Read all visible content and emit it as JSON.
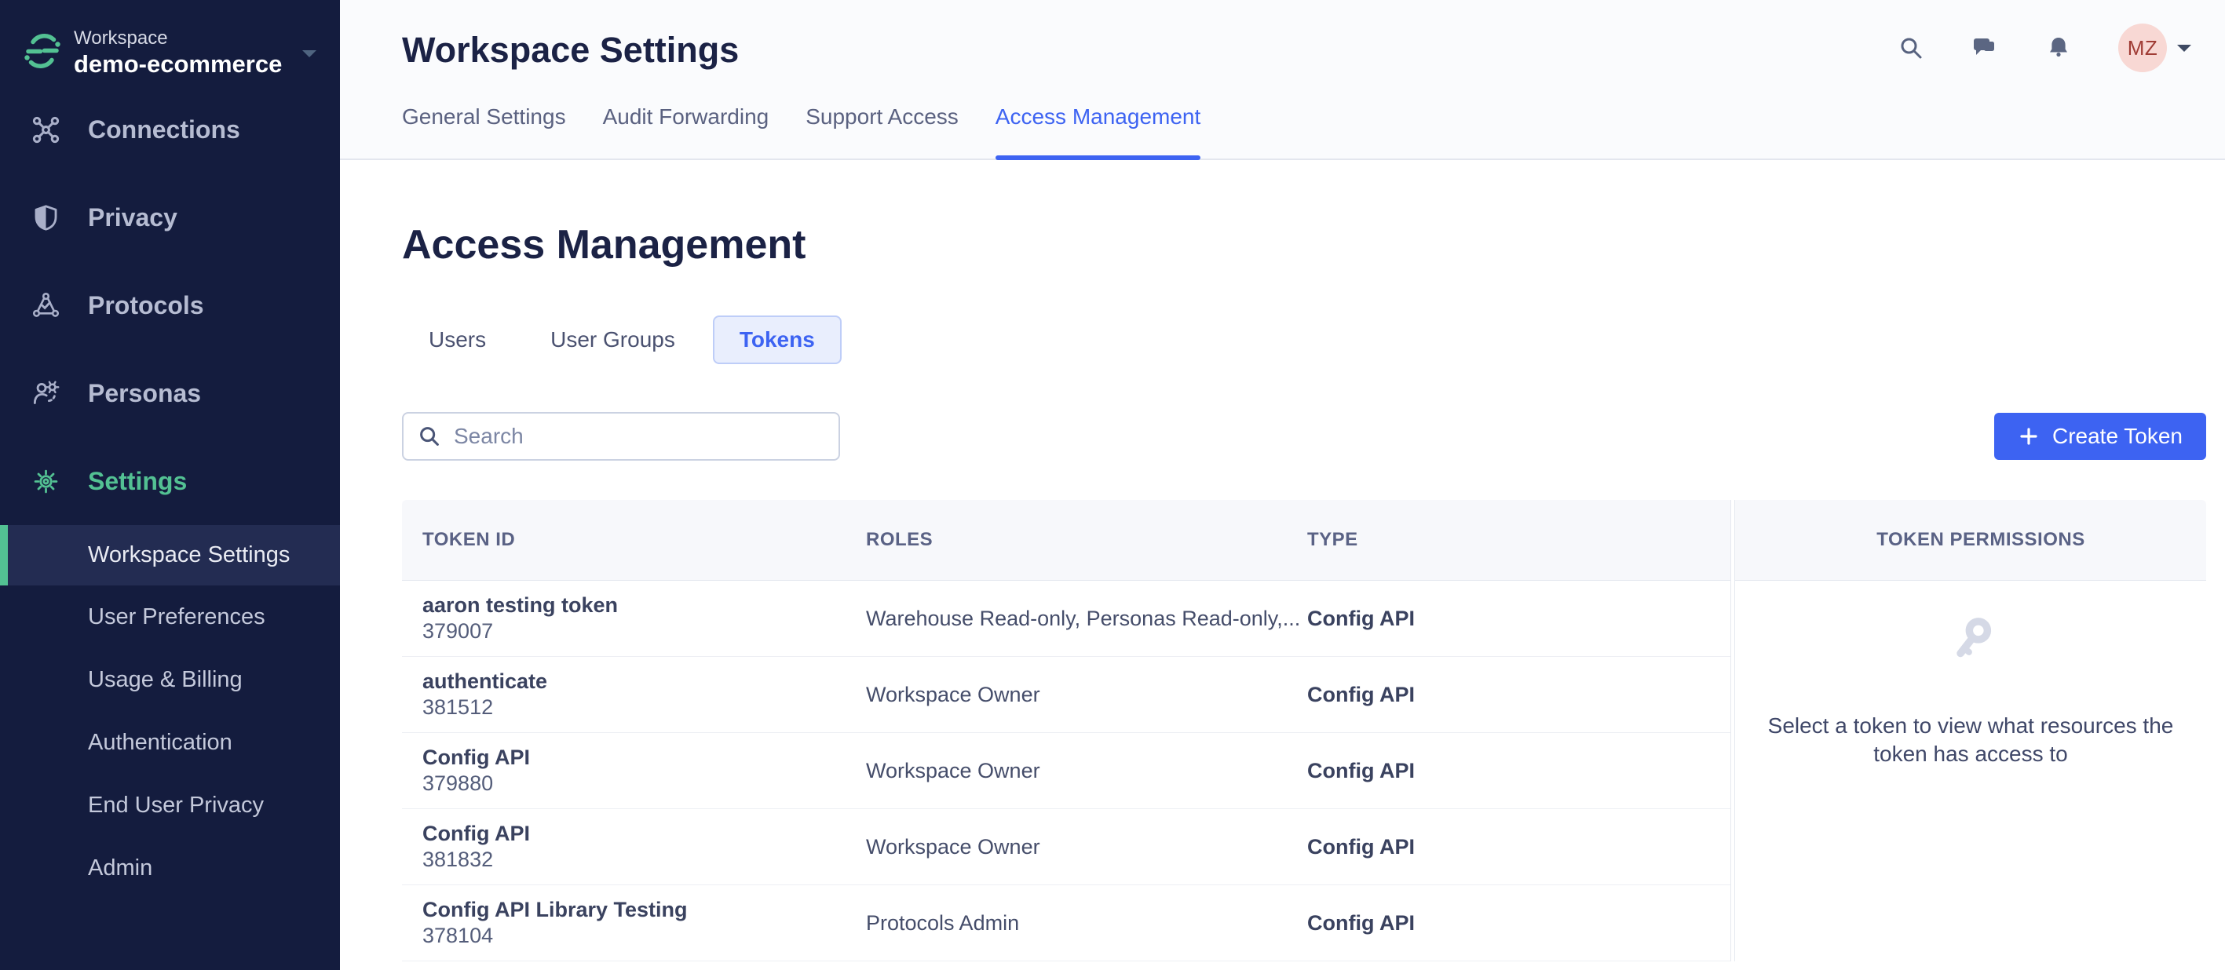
{
  "colors": {
    "sidebar_bg": "#141C3E",
    "sidebar_active_bg": "#232C52",
    "brand_green": "#53C193",
    "accent_blue": "#3D63F2",
    "pill_bg": "#E9EEFD",
    "pill_border": "#BECDF8",
    "header_bg": "#FAFBFD",
    "table_header_bg": "#F7F8FB",
    "avatar_bg": "#F8D8D4",
    "avatar_text": "#A03C35",
    "dark_text": "#1B2245"
  },
  "sidebar": {
    "workspace_label": "Workspace",
    "workspace_name": "demo-ecommerce",
    "nav": [
      {
        "label": "Connections"
      },
      {
        "label": "Privacy"
      },
      {
        "label": "Protocols"
      },
      {
        "label": "Personas"
      },
      {
        "label": "Settings",
        "active": true
      }
    ],
    "subnav": [
      {
        "label": "Workspace Settings",
        "active": true
      },
      {
        "label": "User Preferences"
      },
      {
        "label": "Usage & Billing"
      },
      {
        "label": "Authentication"
      },
      {
        "label": "End User Privacy"
      },
      {
        "label": "Admin"
      }
    ]
  },
  "header": {
    "title": "Workspace Settings",
    "tabs": [
      {
        "label": "General Settings"
      },
      {
        "label": "Audit Forwarding"
      },
      {
        "label": "Support Access"
      },
      {
        "label": "Access Management",
        "active": true
      }
    ],
    "avatar_initials": "MZ"
  },
  "main": {
    "heading": "Access Management",
    "tabs": [
      {
        "label": "Users"
      },
      {
        "label": "User Groups"
      },
      {
        "label": "Tokens",
        "active": true
      }
    ],
    "search_placeholder": "Search",
    "create_label": "Create Token",
    "table": {
      "columns": [
        "TOKEN ID",
        "ROLES",
        "TYPE"
      ],
      "rows": [
        {
          "name": "aaron testing token",
          "id": "379007",
          "roles": "Warehouse Read-only, Personas Read-only,...",
          "type": "Config API"
        },
        {
          "name": "authenticate",
          "id": "381512",
          "roles": "Workspace Owner",
          "type": "Config API"
        },
        {
          "name": "Config API",
          "id": "379880",
          "roles": "Workspace Owner",
          "type": "Config API"
        },
        {
          "name": "Config API",
          "id": "381832",
          "roles": "Workspace Owner",
          "type": "Config API"
        },
        {
          "name": "Config API Library Testing",
          "id": "378104",
          "roles": "Protocols Admin",
          "type": "Config API"
        }
      ]
    },
    "panel": {
      "title": "TOKEN PERMISSIONS",
      "empty_text": [
        "Select a token to view what resources the",
        "token has access to"
      ]
    }
  }
}
